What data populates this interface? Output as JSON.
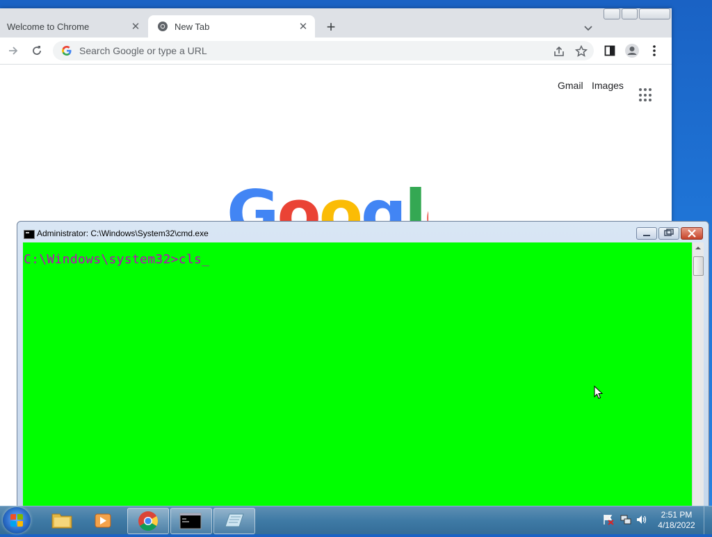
{
  "chrome": {
    "tabs": [
      {
        "label": "Welcome to Chrome",
        "close": "✕"
      },
      {
        "label": "New Tab",
        "close": "✕"
      }
    ],
    "new_tab": "+",
    "omnibox_placeholder": "Search Google or type a URL",
    "links": {
      "gmail": "Gmail",
      "images": "Images"
    },
    "logo": [
      "G",
      "o",
      "o",
      "g",
      "l",
      "e"
    ],
    "logo_colors": [
      "#4285f4",
      "#ea4335",
      "#fbbc05",
      "#4285f4",
      "#34a853",
      "#ea4335"
    ],
    "icons": [
      "forward-icon",
      "reload-icon",
      "share-icon",
      "bookmark-star-icon",
      "side-panel-icon",
      "profile-icon",
      "menu-icon",
      "apps-icon"
    ]
  },
  "cmd": {
    "title": "Administrator: C:\\Windows\\System32\\cmd.exe",
    "prompt_line": "C:\\Windows\\system32>cls_",
    "console_bg": "#00ff00",
    "text_color": "#c000c0"
  },
  "taskbar": {
    "pinned": [
      "explorer-icon",
      "media-player-icon",
      "chrome-icon",
      "cmd-icon",
      "notepad-icon"
    ],
    "tray_icons": [
      "action-center-flag-icon",
      "network-icon",
      "volume-icon"
    ],
    "time": "2:51 PM",
    "date": "4/18/2022"
  }
}
